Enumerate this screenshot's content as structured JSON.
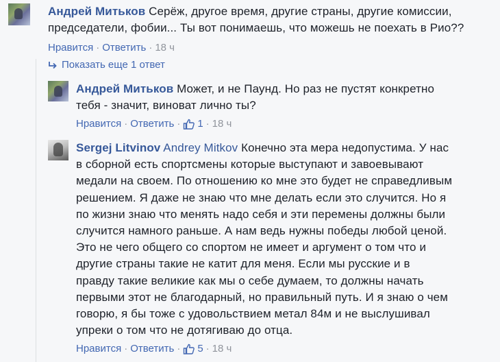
{
  "comments": [
    {
      "author": "Андрей Митьков",
      "lines": [
        "Серёж, другое время, другие страны, другие комиссии,",
        "председатели, фобии... Ты вот понимаешь, что можешь не поехать в Рио??"
      ],
      "like_label": "Нравится",
      "reply_label": "Ответить",
      "time": "18 ч"
    },
    {
      "author": "Андрей Митьков",
      "lines": [
        "Может, и не Паунд. Но раз не пустят конкретно",
        "тебя - значит, виноват лично ты?"
      ],
      "like_label": "Нравится",
      "reply_label": "Ответить",
      "likes": "1",
      "time": "18 ч"
    },
    {
      "author": "Sergej Litvinov",
      "mention": "Andrey Mitkov",
      "lines": [
        "Конечно эта мера недопустима. У нас",
        "в сборной есть спортсмены которые выступают и завоевывают",
        "медали на своем. По отношению ко мне это будет не справедливым",
        "решением. Я даже не знаю что мне делать если это случится. Но я",
        "по жизни знаю что менять надо себя и эти перемены должны были",
        "случится намного раньше. А нам ведь нужны победы любой ценой.",
        "Это не чего общего со спортом не имеет и аргумент о том что и",
        "другие страны такие не катит для меня. Если мы русские и в",
        "правду такие великие как мы о себе думаем, то должны начать",
        "первыми этот не благодарный, но правильный путь. И я знаю о чем",
        "говорю, я бы тоже с удовольствием метал 84м и не выслушивал",
        "упреки о том что не дотягиваю до отца."
      ],
      "like_label": "Нравится",
      "reply_label": "Ответить",
      "likes": "5",
      "time": "18 ч"
    }
  ],
  "more_replies": "Показать еще 1 ответ",
  "separator": "·",
  "icons": {
    "reply_arrow": "reply-arrow-icon",
    "like": "thumbs-up-icon"
  },
  "colors": {
    "link": "#4267b2",
    "author": "#365899",
    "meta": "#90949c",
    "background": "#f6f7f9"
  }
}
